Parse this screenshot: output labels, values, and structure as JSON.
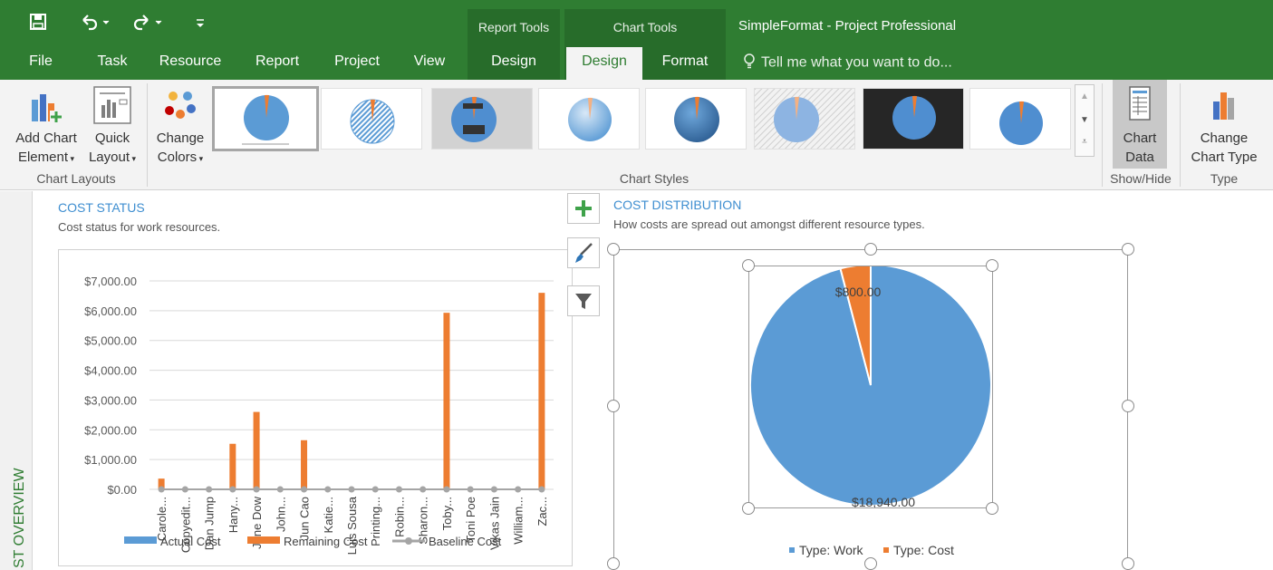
{
  "colors": {
    "ribbon_green": "#2f7d32",
    "accent_blue": "#3e8ed0",
    "series_blue": "#5b9bd5",
    "series_orange": "#ed7d31",
    "series_gray": "#a5a5a5"
  },
  "quick_access": {
    "save_icon": "save-icon",
    "undo_icon": "undo-icon",
    "redo_icon": "redo-icon",
    "customize_icon": "customize-icon"
  },
  "context_groups": {
    "report_tools": "Report Tools",
    "chart_tools": "Chart Tools"
  },
  "title": "SimpleFormat - Project Professional",
  "tabs": [
    "File",
    "Task",
    "Resource",
    "Report",
    "Project",
    "View",
    "Design",
    "Design",
    "Format"
  ],
  "tell_me": "Tell me what you want to do...",
  "ribbon": {
    "add_chart_element": [
      "Add Chart",
      "Element"
    ],
    "quick_layout": [
      "Quick",
      "Layout"
    ],
    "change_colors": [
      "Change",
      "Colors"
    ],
    "group_chart_layouts": "Chart Layouts",
    "group_chart_styles": "Chart Styles",
    "chart_data": [
      "Chart",
      "Data"
    ],
    "group_show_hide": "Show/Hide",
    "change_chart_type": [
      "Change",
      "Chart Type"
    ],
    "group_type": "Type"
  },
  "side_rail_label": "ST OVERVIEW",
  "cost_status": {
    "title": "COST STATUS",
    "subtitle": "Cost status for work resources."
  },
  "cost_distribution": {
    "title": "COST DISTRIBUTION",
    "subtitle": "How costs are spread out amongst different resource types."
  },
  "chart_data": [
    {
      "type": "bar",
      "categories": [
        "Carole...",
        "Copyedit...",
        "Dan Jump",
        "Hany...",
        "Jane Dow",
        "John...",
        "Jun Cao",
        "Katie...",
        "Luis Sousa",
        "Printing...",
        "Robin...",
        "Sharon...",
        "Toby...",
        "Toni Poe",
        "Vikas Jain",
        "William...",
        "Zac..."
      ],
      "ylim": [
        0,
        7000
      ],
      "yticks": [
        "$0.00",
        "$1,000.00",
        "$2,000.00",
        "$3,000.00",
        "$4,000.00",
        "$5,000.00",
        "$6,000.00",
        "$7,000.00"
      ],
      "grid": true,
      "legend": "bottom",
      "series": [
        {
          "name": "Actual Cost",
          "values": [
            0,
            0,
            0,
            0,
            0,
            0,
            0,
            0,
            0,
            0,
            0,
            0,
            0,
            0,
            0,
            0,
            0
          ]
        },
        {
          "name": "Remaining Cost",
          "values": [
            360,
            0,
            0,
            1530,
            2600,
            0,
            1650,
            0,
            0,
            0,
            0,
            0,
            5930,
            0,
            0,
            0,
            6600
          ]
        },
        {
          "name": "Baseline Cost",
          "values": [
            0,
            0,
            0,
            0,
            0,
            0,
            0,
            0,
            0,
            0,
            0,
            0,
            0,
            0,
            0,
            0,
            0
          ]
        }
      ]
    },
    {
      "type": "pie",
      "legend": "bottom",
      "series": [
        {
          "name": "Type: Work",
          "value": 18940,
          "label": "$18,940.00"
        },
        {
          "name": "Type: Cost",
          "value": 800,
          "label": "$800.00"
        }
      ]
    }
  ]
}
